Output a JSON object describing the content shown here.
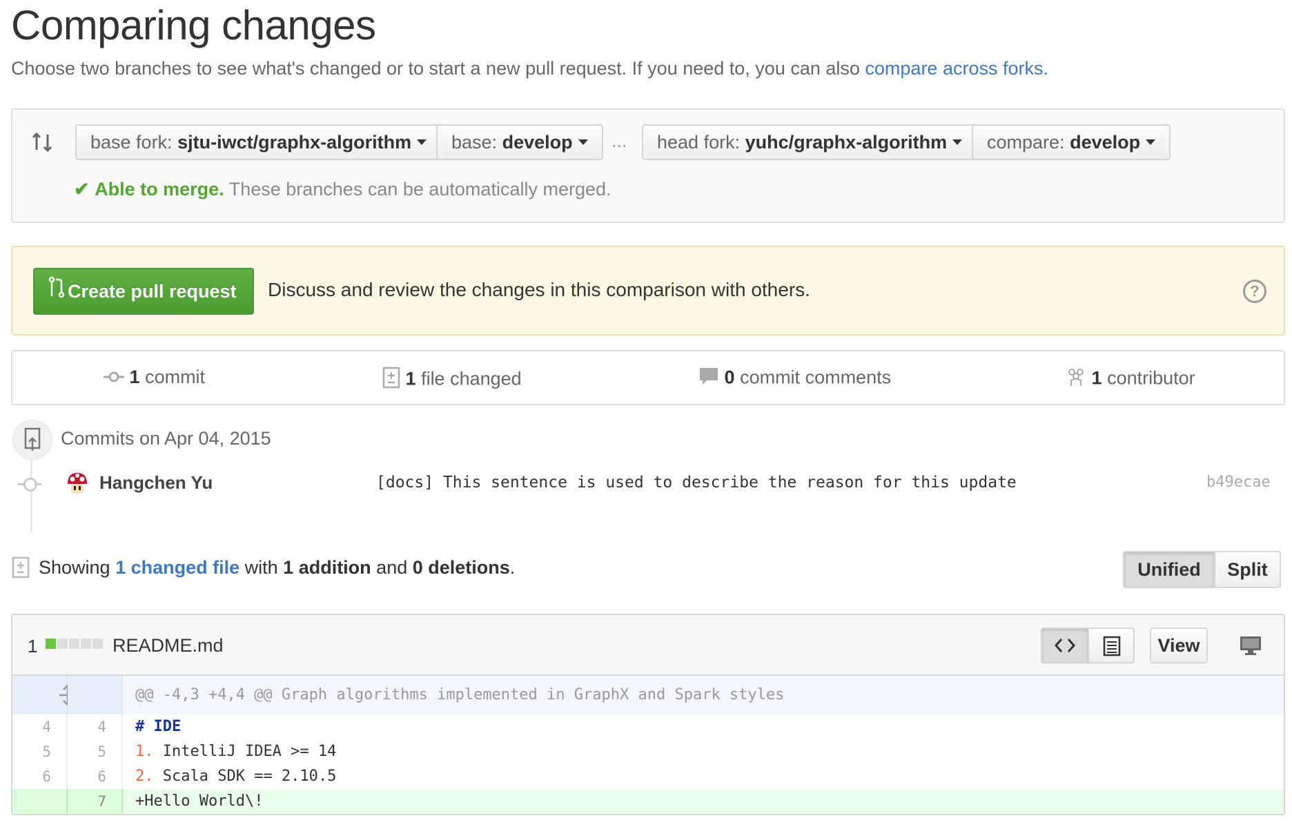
{
  "page": {
    "title": "Comparing changes",
    "subtitle_prefix": "Choose two branches to see what's changed or to start a new pull request. If you need to, you can also ",
    "subtitle_link": "compare across forks."
  },
  "range": {
    "base_fork_label": "base fork:",
    "base_fork_value": "sjtu-iwct/graphx-algorithm",
    "base_label": "base:",
    "base_value": "develop",
    "ellipsis": "...",
    "head_fork_label": "head fork:",
    "head_fork_value": "yuhc/graphx-algorithm",
    "compare_label": "compare:",
    "compare_value": "develop",
    "merge_ok": "Able to merge.",
    "merge_text": "These branches can be automatically merged."
  },
  "pull_request": {
    "button_label": "Create pull request",
    "description": "Discuss and review the changes in this comparison with others.",
    "help_icon": "?"
  },
  "summary": {
    "commits_count": "1",
    "commits_label": "commit",
    "files_count": "1",
    "files_label": "file changed",
    "comments_count": "0",
    "comments_label": "commit comments",
    "contributors_count": "1",
    "contributors_label": "contributor"
  },
  "commits": {
    "group_title": "Commits on Apr 04, 2015",
    "items": [
      {
        "author": "Hangchen Yu",
        "message": "[docs] This sentence is used to describe the reason for this update",
        "sha": "b49ecae"
      }
    ]
  },
  "diff_summary": {
    "prefix": "Showing ",
    "changed_link": "1 changed file",
    "with": " with ",
    "additions": "1 addition",
    "and": " and ",
    "deletions": "0 deletions",
    "suffix": ".",
    "unified_label": "Unified",
    "split_label": "Split"
  },
  "file": {
    "changes": "1",
    "name": "README.md",
    "view_label": "View",
    "stat_colors": [
      "#6cc644",
      "#dddddd",
      "#dddddd",
      "#dddddd",
      "#dddddd"
    ],
    "hunk_header": "@@ -4,3 +4,4 @@ Graph algorithms implemented in GraphX and Spark styles",
    "lines": [
      {
        "old": "4",
        "new": "4",
        "marker": "",
        "bullet": "",
        "text": "# IDE"
      },
      {
        "old": "5",
        "new": "5",
        "marker": "",
        "bullet": "1.",
        "text": " IntelliJ IDEA >= 14"
      },
      {
        "old": "6",
        "new": "6",
        "marker": "",
        "bullet": "2.",
        "text": " Scala SDK == 2.10.5"
      },
      {
        "old": "",
        "new": "7",
        "marker": "+",
        "bullet": "",
        "text": "Hello World\\!"
      }
    ]
  },
  "colors": {
    "link": "#4078c0",
    "green": "#55a532",
    "addition_bg": "#eaffea"
  }
}
